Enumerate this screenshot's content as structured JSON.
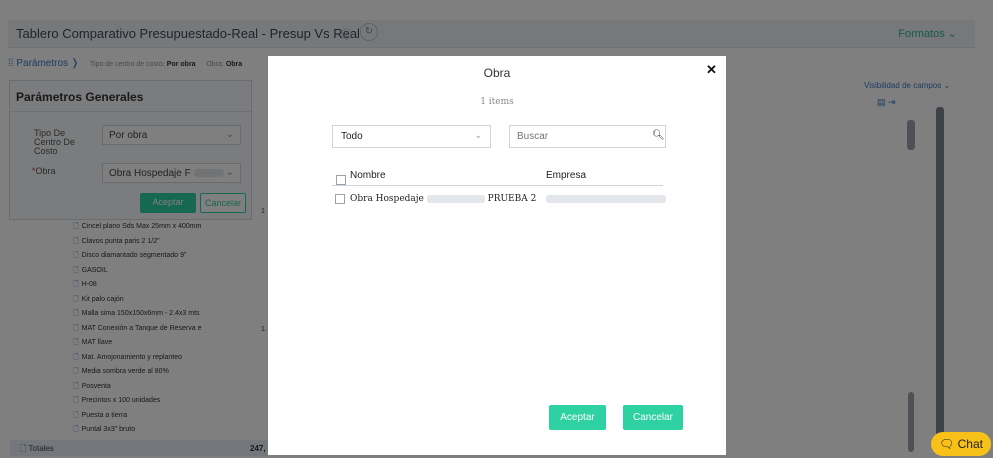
{
  "app": {
    "title": "Tablero Comparativo Presupuestado-Real - Presup Vs Real",
    "formatos_label": "Formatos",
    "parametros_link": "Parámetros",
    "crumb_tipo_label": "Tipo de centro de costo:",
    "crumb_tipo_value": "Por obra",
    "crumb_obra_label": "Obra:",
    "crumb_obra_value": "Obra",
    "visibilidad_label": "Visibilidad de campos"
  },
  "params_panel": {
    "title": "Parámetros Generales",
    "tipo_label": "Tipo De Centro De Costo",
    "tipo_value": "Por obra",
    "obra_label": "Obra",
    "obra_value": "Obra Hospedaje F",
    "accept_label": "Aceptar",
    "cancel_label": "Cancelar"
  },
  "tree_items": [
    "Cincel plano Sds Max 25mm x 400mm",
    "Clavos punta paris 2 1/2\"",
    "Disco diamantado segmentado 9\"",
    "GASOIL",
    "H-08",
    "Kit palo cajón",
    "Malla sima 150x150x6mm - 2.4x3 mts",
    "MAT Conexión a Tanque de Reserva e",
    "MAT llave",
    "Mat. Amojonamiento y replanteo",
    "Media sombra verde al 80%",
    "Posventa",
    "Precintos x 100 unidades",
    "Puesta a tierra",
    "Puntal 3x3\" bruto"
  ],
  "totals": {
    "label": "Totales",
    "value": "247,"
  },
  "modal": {
    "title": "Obra",
    "count": "1 items",
    "filter_value": "Todo",
    "search_placeholder": "Buscar",
    "col_nombre": "Nombre",
    "col_empresa": "Empresa",
    "rows": [
      {
        "nombre_prefix": "Obra Hospedaje",
        "nombre_suffix": "PRUEBA 2"
      }
    ],
    "accept_label": "Aceptar",
    "cancel_label": "Cancelar"
  },
  "chat_label": "Chat",
  "colors": {
    "accent": "#2ed1a2",
    "link": "#3a78c8",
    "chat": "#f7c11a"
  }
}
